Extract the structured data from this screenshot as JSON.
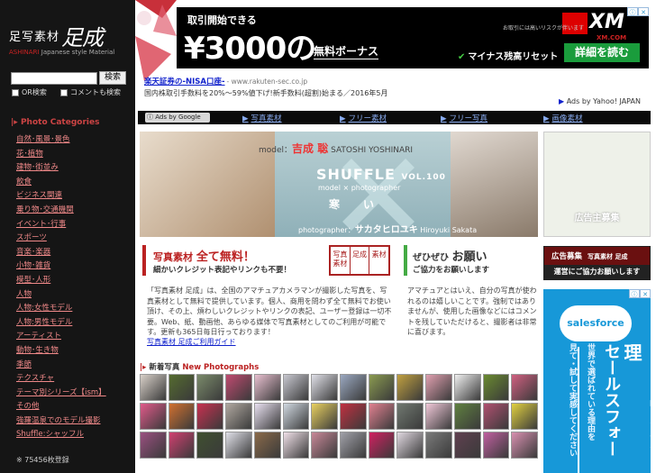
{
  "sidebar": {
    "logo_jp": "足写素材",
    "logo_big": "足成",
    "logo_sub_brand": "ASHINARI",
    "logo_sub_tag": "Japanese style Material",
    "search_button": "検索",
    "or_search": "OR検索",
    "comment_search": "コメントも検索",
    "categories_heading": "Photo Categories",
    "categories": [
      "自然･風景･景色",
      "花･植物",
      "建物･街並み",
      "飲食",
      "ビジネス関連",
      "乗り物･交通機関",
      "イベント･行事",
      "スポーツ",
      "音楽･楽器",
      "小物･雑貨",
      "模型･人形",
      "人物",
      "人物:女性モデル",
      "人物:男性モデル",
      "アーティスト",
      "動物･生き物",
      "季節",
      "テクスチャ",
      "テーマ別シリーズ【ism】",
      "その他",
      "強羅温泉でのモデル撮影",
      "Shuffle:シャッフル"
    ],
    "photo_count": "※ 75456枚登録"
  },
  "banner": {
    "line1": "取引開始できる",
    "amount": "¥3000の",
    "bonus": "無料ボーナス",
    "brand": "XM",
    "brand_sub": "XM.COM",
    "risk": "お取引には高いリスクが伴います",
    "check": "マイナス残高リセット",
    "cta": "詳細を読む"
  },
  "text_ad": {
    "title": "楽天証券の-NISA口座-",
    "url": "- www.rakuten-sec.co.jp",
    "desc": "国内株取引手数料を20%～59%値下げ!新手数料(超割)始まる／2016年5月"
  },
  "yahoo_label": "Ads by Yahoo! JAPAN",
  "nav": {
    "google_label": "Ads by Google",
    "links": [
      "写真素材",
      "フリー素材",
      "フリー写真",
      "画像素材"
    ]
  },
  "hero": {
    "model_prefix": "model：",
    "model_name": "吉成 聡",
    "model_roman": "SATOSHI YOSHINARI",
    "series": "SHUFFLE",
    "volume": "VOL.100",
    "subtitle": "model × photographer",
    "theme": "寒い",
    "photographer_prefix": "photographer：",
    "photographer_name": "サカタヒロユキ",
    "photographer_roman": "Hiroyuki Sakata"
  },
  "side_ad_label": "広告主募集",
  "free_box": {
    "prefix": "写真素材",
    "title": "全て無料！",
    "subtitle": "細かいクレジット表記やリンクも不要！"
  },
  "stamp": [
    "写真素材",
    "足成",
    "素材"
  ],
  "request_box": {
    "prefix": "ぜひぜひ",
    "title": "お願い",
    "subtitle": "ご協力をお願いします"
  },
  "recruit": {
    "label": "広告募集",
    "sub": "写真素材 足成",
    "bar": "運営にご協力お願いします"
  },
  "intro": "「写真素材 足成」は、全国のアマチュアカメラマンが撮影した写真を、写真素材として無料で提供しています。個人、商用を問わず全て無料でお使い頂け、その上、煩わしいクレジットやリンクの表記、ユーザー登録は一切不要。Web、紙、動画他、あらゆる媒体で写真素材としてのご利用が可能です。更新も365日毎日行っております！",
  "intro_link": "写真素材 足成ご利用ガイド",
  "request_text": "アマチュアとはいえ、自分の写真が使われるのは嬉しいことです。強制ではありませんが、使用した画像などにはコメントを残していただけると、撮影者は非常に喜びます。",
  "new_photos": {
    "jp": "新着写真",
    "en": "New Photographs",
    "colors": [
      "#d8d0c8",
      "#556b2f",
      "#7a8a6a",
      "#c04a70",
      "#e8c0d0",
      "#c8c8d0",
      "#e0e0e8",
      "#9aa8c0",
      "#8a9a50",
      "#c0a040",
      "#e0a0b0",
      "#f0f0f0",
      "#6a8a30",
      "#d06080",
      "#e05a8a",
      "#d07030",
      "#c83050",
      "#b0a8a0",
      "#e8e0f0",
      "#d0d8e0",
      "#e8d060",
      "#c03040",
      "#e08090",
      "#707870",
      "#f0c8d8",
      "#608040",
      "#b05070",
      "#e0d040",
      "#9a5080",
      "#d04070",
      "#405030",
      "#e0e0e8",
      "#8a6a4a",
      "#f0e0e8",
      "#c88898",
      "#a0a0a8",
      "#d02060",
      "#e0d8e0",
      "#7a7a7a",
      "#604050",
      "#c060a0",
      "#d890b0"
    ]
  },
  "salesforce": {
    "logo": "salesforce",
    "crm": "CRM【顧客管理",
    "name": "セールスフォー",
    "line1": "世界で選ばれている理由を",
    "line2": "見て・試して実感してください"
  }
}
